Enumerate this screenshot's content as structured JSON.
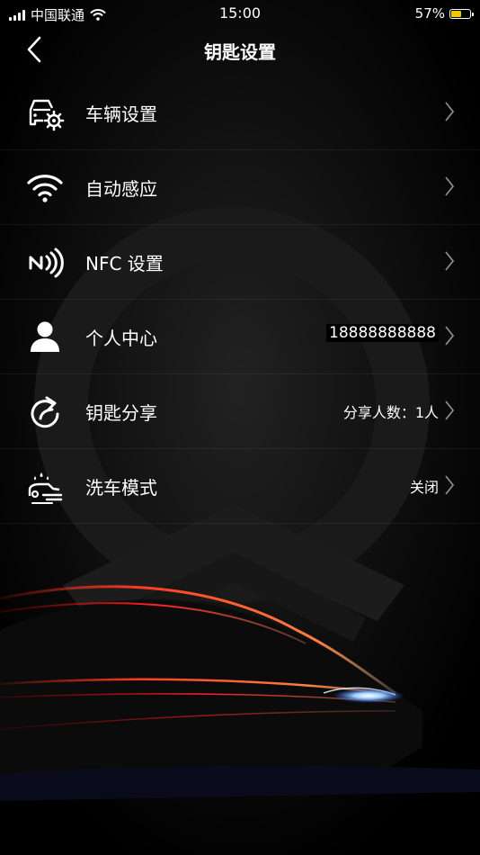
{
  "status_bar": {
    "carrier": "中国联通",
    "time": "15:00",
    "battery_percent_text": "57%",
    "battery_level": 0.57,
    "battery_color": "#f4c400"
  },
  "nav": {
    "title": "钥匙设置",
    "back_icon": "chevron-left-icon"
  },
  "menu": [
    {
      "icon": "car-settings-icon",
      "label": "车辆设置",
      "value": ""
    },
    {
      "icon": "wifi-icon",
      "label": "自动感应",
      "value": ""
    },
    {
      "icon": "nfc-icon",
      "label": "NFC 设置",
      "value": ""
    },
    {
      "icon": "user-icon",
      "label": "个人中心",
      "value": "18888888888"
    },
    {
      "icon": "share-icon",
      "label": "钥匙分享",
      "value": "分享人数：1人"
    },
    {
      "icon": "car-wash-icon",
      "label": "洗车模式",
      "value": "关闭"
    }
  ],
  "colors": {
    "background": "#000000",
    "accent_red": "#e02020"
  }
}
